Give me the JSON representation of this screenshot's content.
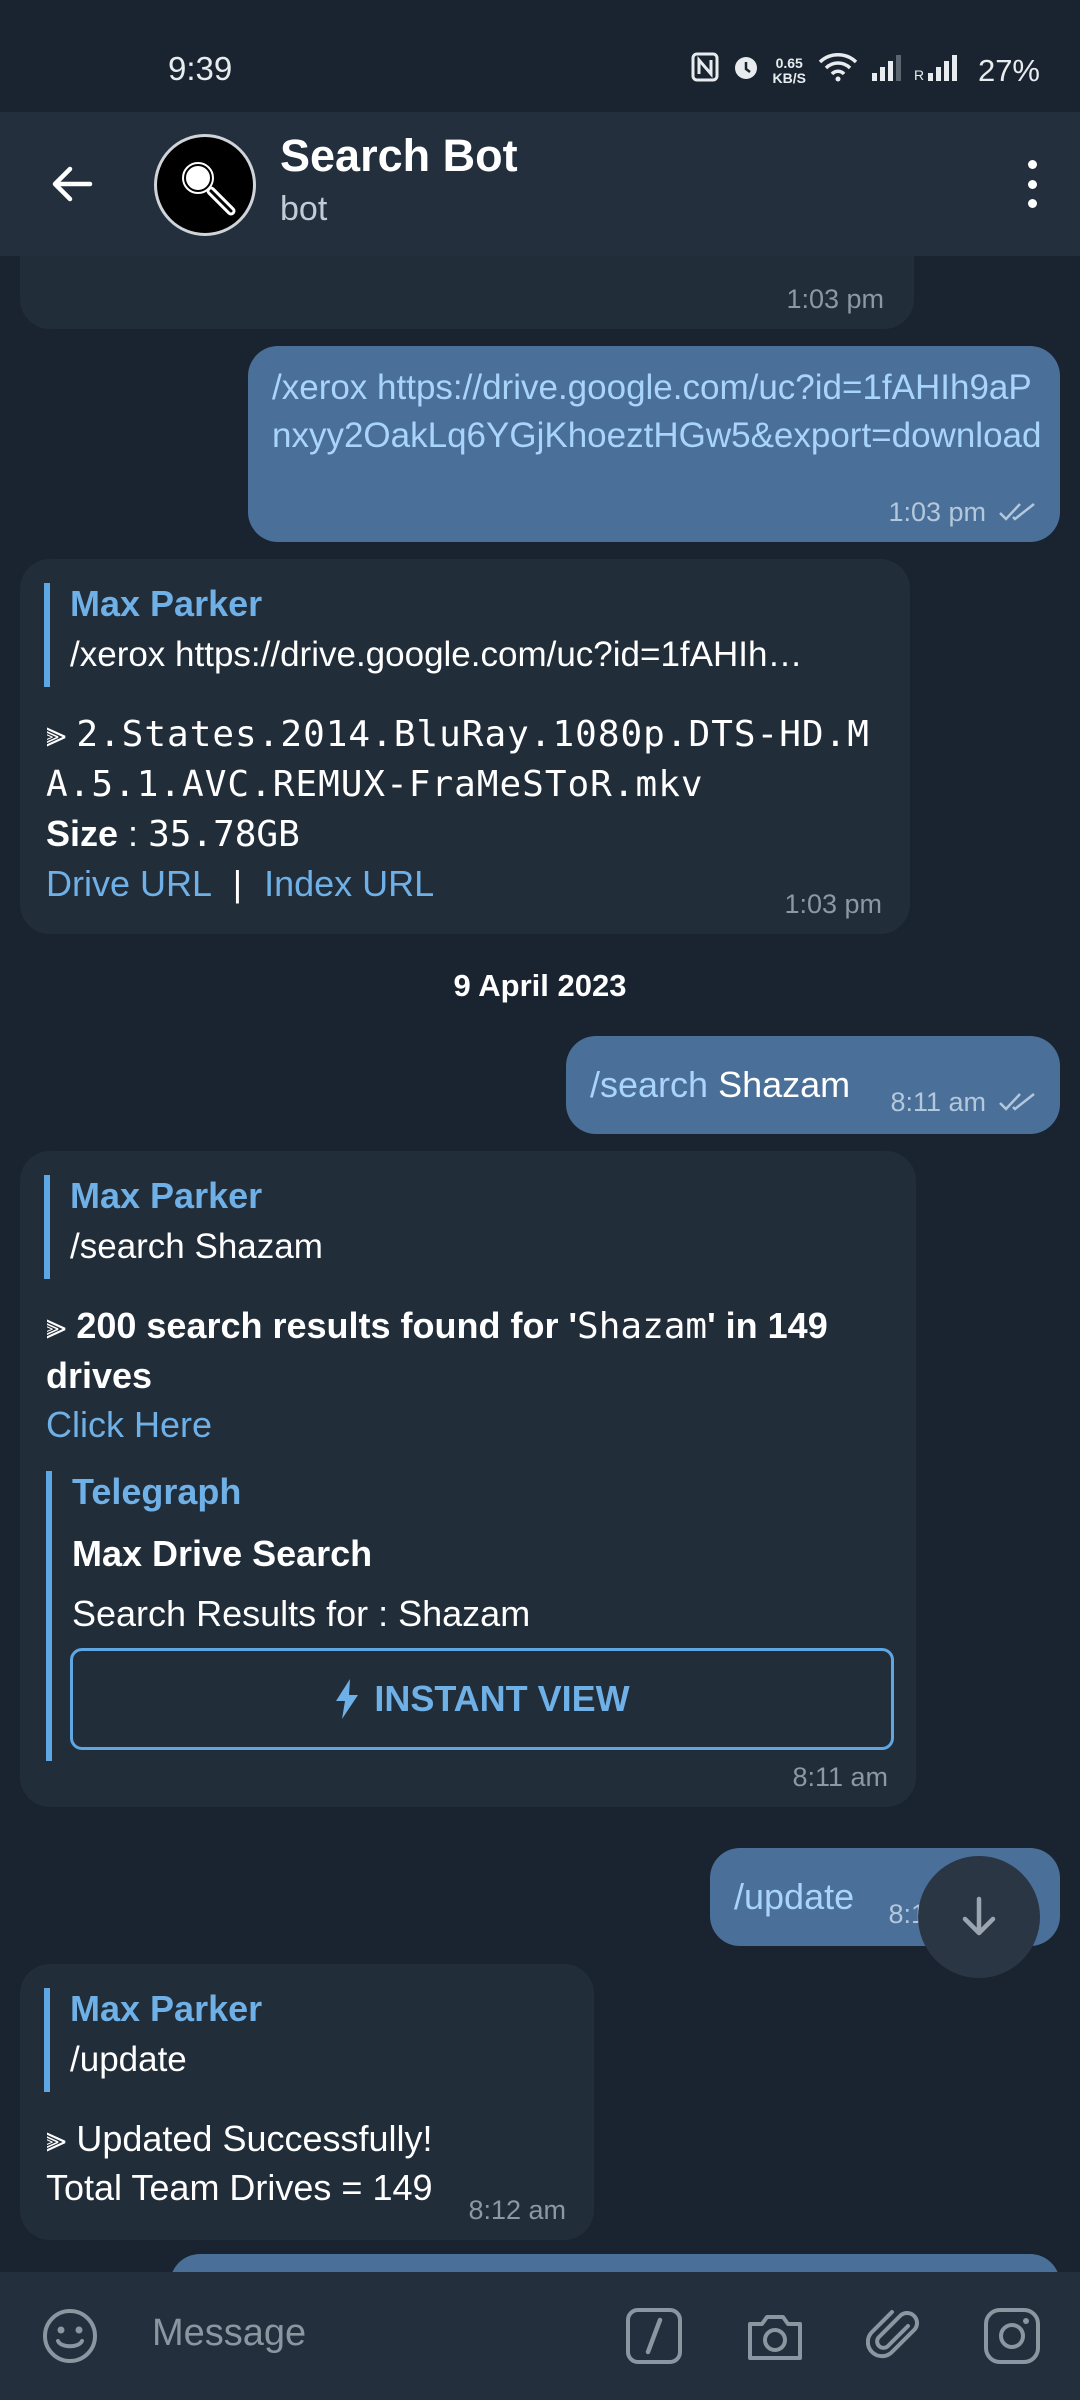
{
  "status": {
    "time": "9:39",
    "speed_value": "0.65",
    "speed_unit": "KB/S",
    "battery": "27%"
  },
  "header": {
    "title": "Search Bot",
    "subtitle": "bot"
  },
  "messages": {
    "m0": {
      "time": "1:03 pm"
    },
    "m1": {
      "command": "/xerox",
      "url": " https://drive.google.com/uc?id=1fAHIh9aPnxyy2OakLq6YGjKhoeztHGw5&export=download",
      "time": "1:03 pm"
    },
    "m2": {
      "quote_name": "Max Parker",
      "quote_text": "/xerox https://drive.google.com/uc?id=1fAHIh…",
      "arrow": "⫸",
      "filename": "2.States.2014.BluRay.1080p.DTS-HD.MA.5.1.AVC.REMUX-FraMeSToR.mkv",
      "size_label": "Size",
      "size_sep": " : ",
      "size_value": "35.78GB",
      "drive_link": "Drive URL",
      "sep": "|",
      "index_link": "Index URL",
      "time": "1:03 pm"
    },
    "date_divider": "9 April 2023",
    "m3": {
      "command": "/search",
      "text": " Shazam",
      "time": "8:11 am"
    },
    "m4": {
      "quote_name": "Max Parker",
      "quote_text": "/search Shazam",
      "arrow": "⫸",
      "result_a": "200 search results found for '",
      "result_query": "Shazam",
      "result_b": "' in 149 drives",
      "link": "Click Here",
      "preview_site": "Telegraph",
      "preview_title": "Max Drive Search",
      "preview_desc": "Search Results for : Shazam",
      "instant_view": "INSTANT VIEW",
      "time": "8:11 am"
    },
    "m5": {
      "command": "/update",
      "time": "8:12 am"
    },
    "m6": {
      "quote_name": "Max Parker",
      "quote_text": "/update",
      "arrow": "⫸",
      "line1": "Updated Successfully!",
      "line2": "Total Team Drives = 149",
      "time": "8:12 am"
    }
  },
  "input": {
    "placeholder": "Message"
  },
  "colors": {
    "incoming": "#222d3a",
    "outgoing": "#4a6f98",
    "accent": "#6fb0e6",
    "background": "#1a2430"
  }
}
